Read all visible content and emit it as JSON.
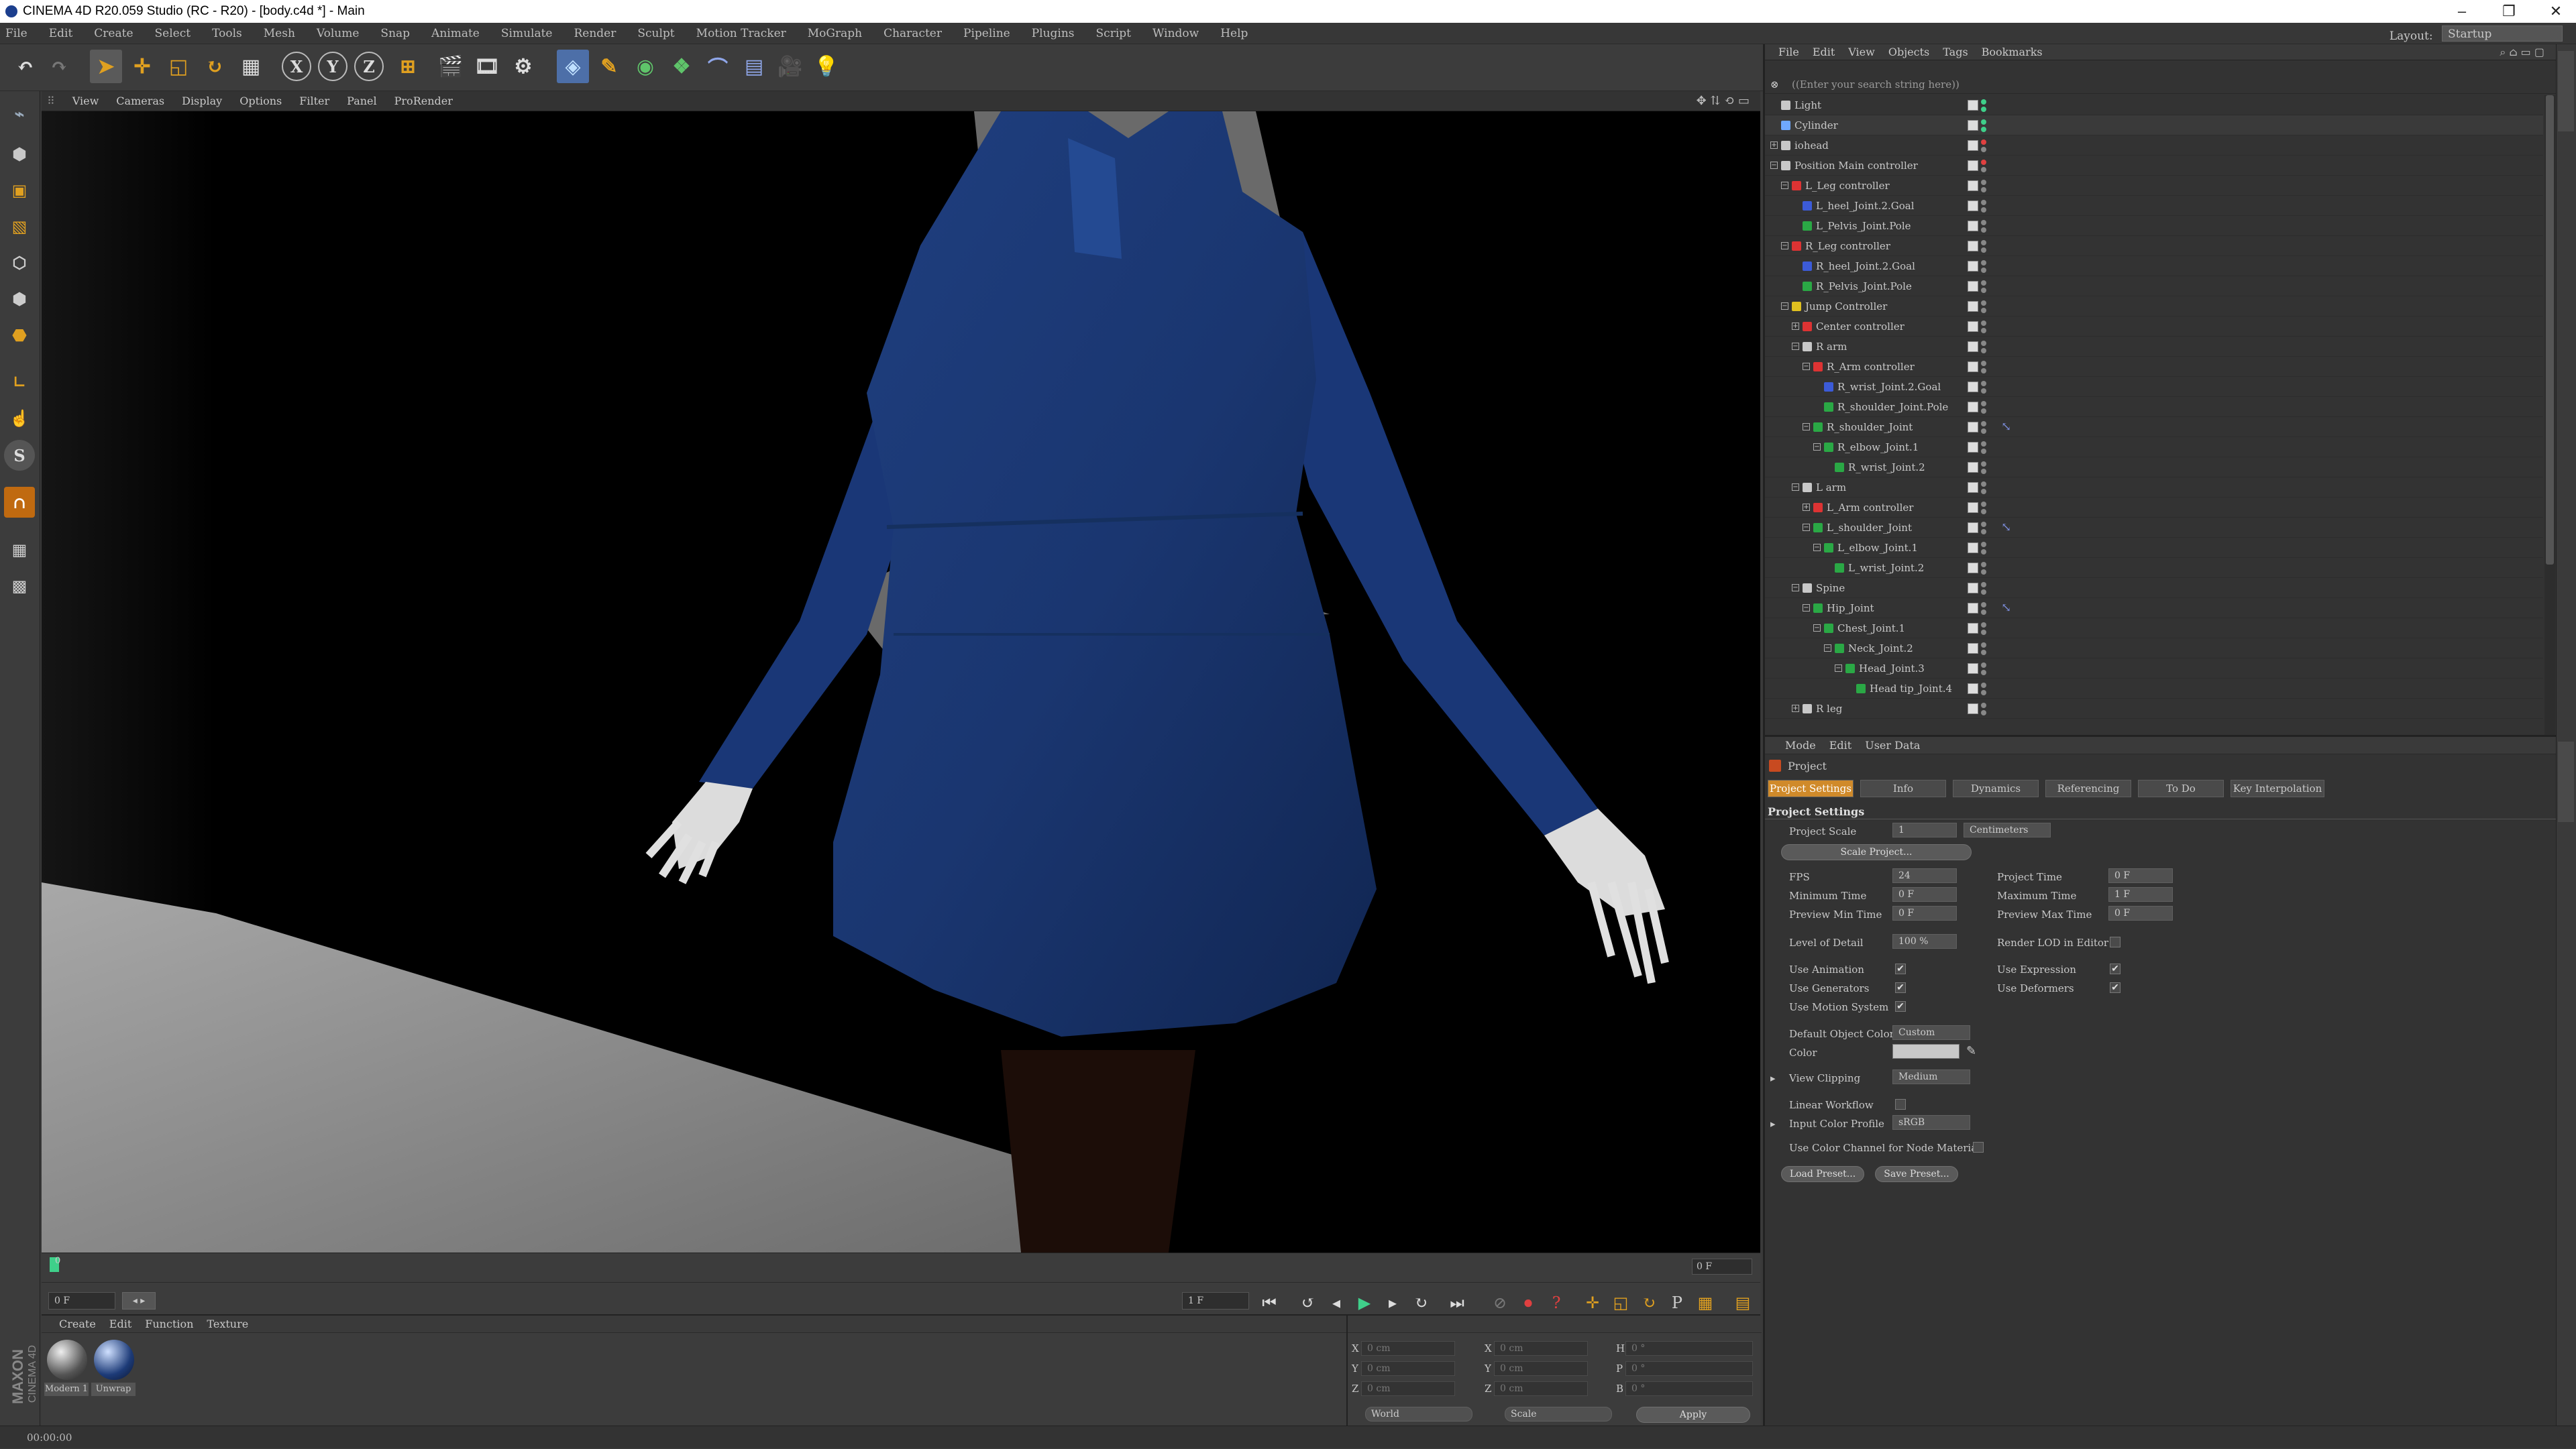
{
  "window": {
    "title": "CINEMA 4D R20.059 Studio (RC - R20) - [body.c4d *] - Main",
    "minimize": "–",
    "restore": "❐",
    "close": "✕"
  },
  "menubar": {
    "items": [
      "File",
      "Edit",
      "Create",
      "Select",
      "Tools",
      "Mesh",
      "Volume",
      "Snap",
      "Animate",
      "Simulate",
      "Render",
      "Sculpt",
      "Motion Tracker",
      "MoGraph",
      "Character",
      "Pipeline",
      "Plugins",
      "Script",
      "Window",
      "Help"
    ],
    "layout_label": "Layout:",
    "layout_value": "Startup"
  },
  "toolbar": {
    "axis_x": "X",
    "axis_y": "Y",
    "axis_z": "Z"
  },
  "viewport": {
    "menu": [
      "View",
      "Cameras",
      "Display",
      "Options",
      "Filter",
      "Panel",
      "ProRender"
    ]
  },
  "timeline": {
    "start_frame": "0",
    "end_frame": "0 F",
    "current_frame": "0 F",
    "fps_field": "1 F"
  },
  "material_manager": {
    "menu": [
      "Create",
      "Edit",
      "Function",
      "Texture"
    ],
    "materials": [
      "Modern 1",
      "Unwrap"
    ],
    "brand_line1": "MAXON",
    "brand_line2": "CINEMA 4D"
  },
  "coordinates": {
    "rows": [
      {
        "axis": "X",
        "pos": "0 cm",
        "size_axis": "X",
        "size": "0 cm",
        "rot_axis": "H",
        "rot": "0 °"
      },
      {
        "axis": "Y",
        "pos": "0 cm",
        "size_axis": "Y",
        "size": "0 cm",
        "rot_axis": "P",
        "rot": "0 °"
      },
      {
        "axis": "Z",
        "pos": "0 cm",
        "size_axis": "Z",
        "size": "0 cm",
        "rot_axis": "B",
        "rot": "0 °"
      }
    ],
    "mode1": "World",
    "mode2": "Scale",
    "apply": "Apply"
  },
  "status": {
    "time": "00:00:00"
  },
  "object_manager": {
    "menu": [
      "File",
      "Edit",
      "View",
      "Objects",
      "Tags",
      "Bookmarks"
    ],
    "search_placeholder": "((Enter your search string here))",
    "objects": [
      {
        "name": "Light",
        "level": 0,
        "color": "#c8c8c8",
        "expander": ""
      },
      {
        "name": "Cylinder",
        "level": 0,
        "color": "#6fa8ff",
        "expander": ""
      },
      {
        "name": "iohead",
        "level": 0,
        "color": "#c8c8c8",
        "expander": "+"
      },
      {
        "name": "Position Main controller",
        "level": 0,
        "color": "#c8c8c8",
        "expander": "−"
      },
      {
        "name": "L_Leg controller",
        "level": 1,
        "color": "#d33",
        "expander": "−"
      },
      {
        "name": "L_heel_Joint.2.Goal",
        "level": 2,
        "color": "#3c5bd8",
        "expander": ""
      },
      {
        "name": "L_Pelvis_Joint.Pole",
        "level": 2,
        "color": "#2aa845",
        "expander": ""
      },
      {
        "name": "R_Leg controller",
        "level": 1,
        "color": "#d33",
        "expander": "−"
      },
      {
        "name": "R_heel_Joint.2.Goal",
        "level": 2,
        "color": "#3c5bd8",
        "expander": ""
      },
      {
        "name": "R_Pelvis_Joint.Pole",
        "level": 2,
        "color": "#2aa845",
        "expander": ""
      },
      {
        "name": "Jump Controller",
        "level": 1,
        "color": "#e0c020",
        "expander": "−"
      },
      {
        "name": "Center controller",
        "level": 2,
        "color": "#d33",
        "expander": "+"
      },
      {
        "name": "R arm",
        "level": 2,
        "color": "#c8c8c8",
        "expander": "−"
      },
      {
        "name": "R_Arm controller",
        "level": 3,
        "color": "#d33",
        "expander": "−"
      },
      {
        "name": "R_wrist_Joint.2.Goal",
        "level": 4,
        "color": "#3c5bd8",
        "expander": ""
      },
      {
        "name": "R_shoulder_Joint.Pole",
        "level": 4,
        "color": "#2aa845",
        "expander": ""
      },
      {
        "name": "R_shoulder_Joint",
        "level": 3,
        "color": "#2aa845",
        "expander": "−"
      },
      {
        "name": "R_elbow_Joint.1",
        "level": 4,
        "color": "#2aa845",
        "expander": "−"
      },
      {
        "name": "R_wrist_Joint.2",
        "level": 5,
        "color": "#2aa845",
        "expander": ""
      },
      {
        "name": "L arm",
        "level": 2,
        "color": "#c8c8c8",
        "expander": "−"
      },
      {
        "name": "L_Arm controller",
        "level": 3,
        "color": "#d33",
        "expander": "+"
      },
      {
        "name": "L_shoulder_Joint",
        "level": 3,
        "color": "#2aa845",
        "expander": "−"
      },
      {
        "name": "L_elbow_Joint.1",
        "level": 4,
        "color": "#2aa845",
        "expander": "−"
      },
      {
        "name": "L_wrist_Joint.2",
        "level": 5,
        "color": "#2aa845",
        "expander": ""
      },
      {
        "name": "Spine",
        "level": 2,
        "color": "#c8c8c8",
        "expander": "−"
      },
      {
        "name": "Hip_Joint",
        "level": 3,
        "color": "#2aa845",
        "expander": "−"
      },
      {
        "name": "Chest_Joint.1",
        "level": 4,
        "color": "#2aa845",
        "expander": "−"
      },
      {
        "name": "Neck_Joint.2",
        "level": 5,
        "color": "#2aa845",
        "expander": "−"
      },
      {
        "name": "Head_Joint.3",
        "level": 6,
        "color": "#2aa845",
        "expander": "−"
      },
      {
        "name": "Head tip_Joint.4",
        "level": 7,
        "color": "#2aa845",
        "expander": ""
      },
      {
        "name": "R leg",
        "level": 2,
        "color": "#c8c8c8",
        "expander": "+"
      }
    ]
  },
  "attributes": {
    "menu": [
      "Mode",
      "Edit",
      "User Data"
    ],
    "object_label": "Project",
    "tabs": [
      "Project Settings",
      "Info",
      "Dynamics",
      "Referencing",
      "To Do",
      "Key Interpolation"
    ],
    "section": "Project Settings",
    "project_scale_label": "Project Scale",
    "project_scale_value": "1",
    "project_scale_unit": "Centimeters",
    "scale_project_btn": "Scale Project...",
    "fps_label": "FPS",
    "fps_value": "24",
    "project_time_label": "Project Time",
    "project_time_value": "0 F",
    "min_time_label": "Minimum Time",
    "min_time_value": "0 F",
    "max_time_label": "Maximum Time",
    "max_time_value": "1 F",
    "prev_min_label": "Preview Min Time",
    "prev_min_value": "0 F",
    "prev_max_label": "Preview Max Time",
    "prev_max_value": "0 F",
    "lod_label": "Level of Detail",
    "lod_value": "100 %",
    "render_lod_label": "Render LOD in Editor",
    "use_animation_label": "Use Animation",
    "use_expression_label": "Use Expression",
    "use_generators_label": "Use Generators",
    "use_deformers_label": "Use Deformers",
    "use_motion_label": "Use Motion System",
    "default_color_label": "Default Object Color",
    "default_color_value": "Custom",
    "color_label": "Color",
    "view_clipping_label": "View Clipping",
    "view_clipping_value": "Medium",
    "linear_workflow_label": "Linear Workflow",
    "input_profile_label": "Input Color Profile",
    "input_profile_value": "sRGB",
    "node_material_label": "Use Color Channel for Node Material",
    "load_preset": "Load Preset...",
    "save_preset": "Save Preset...",
    "check": "✔"
  },
  "colors": {
    "accent_orange": "#d08a2a",
    "dress_blue": "#1d3b78",
    "active_tab": "#d08a2a"
  }
}
